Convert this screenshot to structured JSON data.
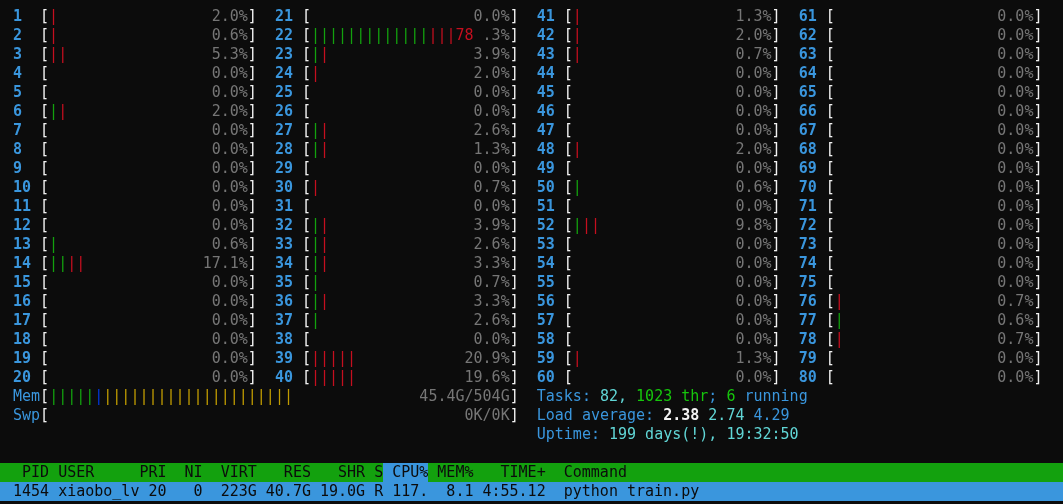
{
  "cpu_meters": [
    {
      "label": "1",
      "open": "[",
      "segments": [
        {
          "text": "|",
          "kind": "kernel"
        }
      ],
      "reading": "2.0%",
      "close": "]"
    },
    {
      "label": "2",
      "open": "[",
      "segments": [
        {
          "text": "|",
          "kind": "kernel"
        }
      ],
      "reading": "0.6%",
      "close": "]"
    },
    {
      "label": "3",
      "open": "[",
      "segments": [
        {
          "text": "||",
          "kind": "kernel"
        }
      ],
      "reading": "5.3%",
      "close": "]"
    },
    {
      "label": "4",
      "open": "[",
      "reading": "0.0%",
      "close": "]"
    },
    {
      "label": "5",
      "open": "[",
      "reading": "0.0%",
      "close": "]"
    },
    {
      "label": "6",
      "open": "[",
      "segments": [
        {
          "text": "|",
          "kind": "normal"
        },
        {
          "text": "|",
          "kind": "kernel"
        }
      ],
      "reading": "2.0%",
      "close": "]"
    },
    {
      "label": "7",
      "open": "[",
      "reading": "0.0%",
      "close": "]"
    },
    {
      "label": "8",
      "open": "[",
      "reading": "0.0%",
      "close": "]"
    },
    {
      "label": "9",
      "open": "[",
      "reading": "0.0%",
      "close": "]"
    },
    {
      "label": "10",
      "open": "[",
      "reading": "0.0%",
      "close": "]"
    },
    {
      "label": "11",
      "open": "[",
      "reading": "0.0%",
      "close": "]"
    },
    {
      "label": "12",
      "open": "[",
      "reading": "0.0%",
      "close": "]"
    },
    {
      "label": "13",
      "open": "[",
      "segments": [
        {
          "text": "|",
          "kind": "normal"
        }
      ],
      "reading": "0.6%",
      "close": "]"
    },
    {
      "label": "14",
      "open": "[",
      "segments": [
        {
          "text": "||",
          "kind": "normal"
        },
        {
          "text": "||",
          "kind": "kernel"
        }
      ],
      "reading": "17.1%",
      "close": "]"
    },
    {
      "label": "15",
      "open": "[",
      "reading": "0.0%",
      "close": "]"
    },
    {
      "label": "16",
      "open": "[",
      "reading": "0.0%",
      "close": "]"
    },
    {
      "label": "17",
      "open": "[",
      "reading": "0.0%",
      "close": "]"
    },
    {
      "label": "18",
      "open": "[",
      "reading": "0.0%",
      "close": "]"
    },
    {
      "label": "19",
      "open": "[",
      "reading": "0.0%",
      "close": "]"
    },
    {
      "label": "20",
      "open": "[",
      "reading": "0.0%",
      "close": "]"
    },
    {
      "label": "21",
      "open": "[",
      "reading": "0.0%",
      "close": "]"
    },
    {
      "label": "22",
      "open": "[",
      "segments": [
        {
          "text": "|||||||||||||",
          "kind": "normal"
        },
        {
          "text": "|||78",
          "kind": "kernel"
        }
      ],
      "reading": ".3%",
      "close": "]"
    },
    {
      "label": "23",
      "open": "[",
      "segments": [
        {
          "text": "|",
          "kind": "normal"
        },
        {
          "text": "|",
          "kind": "kernel"
        }
      ],
      "reading": "3.9%",
      "close": "]"
    },
    {
      "label": "24",
      "open": "[",
      "segments": [
        {
          "text": "|",
          "kind": "kernel"
        }
      ],
      "reading": "2.0%",
      "close": "]"
    },
    {
      "label": "25",
      "open": "[",
      "reading": "0.0%",
      "close": "]"
    },
    {
      "label": "26",
      "open": "[",
      "reading": "0.0%",
      "close": "]"
    },
    {
      "label": "27",
      "open": "[",
      "segments": [
        {
          "text": "|",
          "kind": "normal"
        },
        {
          "text": "|",
          "kind": "kernel"
        }
      ],
      "reading": "2.6%",
      "close": "]"
    },
    {
      "label": "28",
      "open": "[",
      "segments": [
        {
          "text": "|",
          "kind": "normal"
        },
        {
          "text": "|",
          "kind": "kernel"
        }
      ],
      "reading": "1.3%",
      "close": "]"
    },
    {
      "label": "29",
      "open": "[",
      "reading": "0.0%",
      "close": "]"
    },
    {
      "label": "30",
      "open": "[",
      "segments": [
        {
          "text": "|",
          "kind": "kernel"
        }
      ],
      "reading": "0.7%",
      "close": "]"
    },
    {
      "label": "31",
      "open": "[",
      "reading": "0.0%",
      "close": "]"
    },
    {
      "label": "32",
      "open": "[",
      "segments": [
        {
          "text": "|",
          "kind": "normal"
        },
        {
          "text": "|",
          "kind": "kernel"
        }
      ],
      "reading": "3.9%",
      "close": "]"
    },
    {
      "label": "33",
      "open": "[",
      "segments": [
        {
          "text": "|",
          "kind": "normal"
        },
        {
          "text": "|",
          "kind": "kernel"
        }
      ],
      "reading": "2.6%",
      "close": "]"
    },
    {
      "label": "34",
      "open": "[",
      "segments": [
        {
          "text": "|",
          "kind": "normal"
        },
        {
          "text": "|",
          "kind": "kernel"
        }
      ],
      "reading": "3.3%",
      "close": "]"
    },
    {
      "label": "35",
      "open": "[",
      "segments": [
        {
          "text": "|",
          "kind": "normal"
        }
      ],
      "reading": "0.7%",
      "close": "]"
    },
    {
      "label": "36",
      "open": "[",
      "segments": [
        {
          "text": "|",
          "kind": "normal"
        },
        {
          "text": "|",
          "kind": "kernel"
        }
      ],
      "reading": "3.3%",
      "close": "]"
    },
    {
      "label": "37",
      "open": "[",
      "segments": [
        {
          "text": "|",
          "kind": "normal"
        }
      ],
      "reading": "2.6%",
      "close": "]"
    },
    {
      "label": "38",
      "open": "[",
      "reading": "0.0%",
      "close": "]"
    },
    {
      "label": "39",
      "open": "[",
      "segments": [
        {
          "text": "|||||",
          "kind": "kernel"
        }
      ],
      "reading": "20.9%",
      "close": "]"
    },
    {
      "label": "40",
      "open": "[",
      "segments": [
        {
          "text": "|||||",
          "kind": "kernel"
        }
      ],
      "reading": "19.6%",
      "close": "]"
    },
    {
      "label": "41",
      "open": "[",
      "segments": [
        {
          "text": "|",
          "kind": "kernel"
        }
      ],
      "reading": "1.3%",
      "close": "]"
    },
    {
      "label": "42",
      "open": "[",
      "segments": [
        {
          "text": "|",
          "kind": "kernel"
        }
      ],
      "reading": "2.0%",
      "close": "]"
    },
    {
      "label": "43",
      "open": "[",
      "segments": [
        {
          "text": "|",
          "kind": "kernel"
        }
      ],
      "reading": "0.7%",
      "close": "]"
    },
    {
      "label": "44",
      "open": "[",
      "reading": "0.0%",
      "close": "]"
    },
    {
      "label": "45",
      "open": "[",
      "reading": "0.0%",
      "close": "]"
    },
    {
      "label": "46",
      "open": "[",
      "reading": "0.0%",
      "close": "]"
    },
    {
      "label": "47",
      "open": "[",
      "reading": "0.0%",
      "close": "]"
    },
    {
      "label": "48",
      "open": "[",
      "segments": [
        {
          "text": "|",
          "kind": "kernel"
        }
      ],
      "reading": "2.0%",
      "close": "]"
    },
    {
      "label": "49",
      "open": "[",
      "reading": "0.0%",
      "close": "]"
    },
    {
      "label": "50",
      "open": "[",
      "segments": [
        {
          "text": "|",
          "kind": "normal"
        }
      ],
      "reading": "0.6%",
      "close": "]"
    },
    {
      "label": "51",
      "open": "[",
      "reading": "0.0%",
      "close": "]"
    },
    {
      "label": "52",
      "open": "[",
      "segments": [
        {
          "text": "|",
          "kind": "normal"
        },
        {
          "text": "||",
          "kind": "kernel"
        }
      ],
      "reading": "9.8%",
      "close": "]"
    },
    {
      "label": "53",
      "open": "[",
      "reading": "0.0%",
      "close": "]"
    },
    {
      "label": "54",
      "open": "[",
      "reading": "0.0%",
      "close": "]"
    },
    {
      "label": "55",
      "open": "[",
      "reading": "0.0%",
      "close": "]"
    },
    {
      "label": "56",
      "open": "[",
      "reading": "0.0%",
      "close": "]"
    },
    {
      "label": "57",
      "open": "[",
      "reading": "0.0%",
      "close": "]"
    },
    {
      "label": "58",
      "open": "[",
      "reading": "0.0%",
      "close": "]"
    },
    {
      "label": "59",
      "open": "[",
      "segments": [
        {
          "text": "|",
          "kind": "kernel"
        }
      ],
      "reading": "1.3%",
      "close": "]"
    },
    {
      "label": "60",
      "open": "[",
      "reading": "0.0%",
      "close": "]"
    },
    {
      "label": "61",
      "open": "[",
      "reading": "0.0%",
      "close": "]"
    },
    {
      "label": "62",
      "open": "[",
      "reading": "0.0%",
      "close": "]"
    },
    {
      "label": "63",
      "open": "[",
      "reading": "0.0%",
      "close": "]"
    },
    {
      "label": "64",
      "open": "[",
      "reading": "0.0%",
      "close": "]"
    },
    {
      "label": "65",
      "open": "[",
      "reading": "0.0%",
      "close": "]"
    },
    {
      "label": "66",
      "open": "[",
      "reading": "0.0%",
      "close": "]"
    },
    {
      "label": "67",
      "open": "[",
      "reading": "0.0%",
      "close": "]"
    },
    {
      "label": "68",
      "open": "[",
      "reading": "0.0%",
      "close": "]"
    },
    {
      "label": "69",
      "open": "[",
      "reading": "0.0%",
      "close": "]"
    },
    {
      "label": "70",
      "open": "[",
      "reading": "0.0%",
      "close": "]"
    },
    {
      "label": "71",
      "open": "[",
      "reading": "0.0%",
      "close": "]"
    },
    {
      "label": "72",
      "open": "[",
      "reading": "0.0%",
      "close": "]"
    },
    {
      "label": "73",
      "open": "[",
      "reading": "0.0%",
      "close": "]"
    },
    {
      "label": "74",
      "open": "[",
      "reading": "0.0%",
      "close": "]"
    },
    {
      "label": "75",
      "open": "[",
      "reading": "0.0%",
      "close": "]"
    },
    {
      "label": "76",
      "open": "[",
      "segments": [
        {
          "text": "|",
          "kind": "kernel"
        }
      ],
      "reading": "0.7%",
      "close": "]"
    },
    {
      "label": "77",
      "open": "[",
      "segments": [
        {
          "text": "|",
          "kind": "normal"
        }
      ],
      "reading": "0.6%",
      "close": "]"
    },
    {
      "label": "78",
      "open": "[",
      "segments": [
        {
          "text": "|",
          "kind": "kernel"
        }
      ],
      "reading": "0.7%",
      "close": "]"
    },
    {
      "label": "79",
      "open": "[",
      "reading": "0.0%",
      "close": "]"
    },
    {
      "label": "80",
      "open": "[",
      "reading": "0.0%",
      "close": "]"
    }
  ],
  "memory_meters": [
    {
      "label": "Mem",
      "open": "[",
      "segments": [
        {
          "text": "|||||",
          "kind": "normal"
        },
        {
          "text": "|",
          "kind": "buffers"
        },
        {
          "text": "|||||||||||||||||||||",
          "kind": "cache"
        }
      ],
      "reading": "45.4G/504G",
      "close": "]"
    },
    {
      "label": "Swp",
      "open": "[",
      "reading": "0K/0K",
      "close": "]"
    }
  ],
  "summary_lines": [
    {
      "segments": [
        {
          "text": "Tasks: ",
          "kind": "label"
        },
        {
          "text": "82, ",
          "kind": "value"
        },
        {
          "text": "1023 thr",
          "kind": "highlight"
        },
        {
          "text": "; ",
          "kind": "label"
        },
        {
          "text": "6",
          "kind": "highlight"
        },
        {
          "text": " running",
          "kind": "label"
        }
      ]
    },
    {
      "segments": [
        {
          "text": "Load average: ",
          "kind": "label"
        },
        {
          "text": "2.38 ",
          "kind": "bright"
        },
        {
          "text": "2.74 ",
          "kind": "value"
        },
        {
          "text": "4.29",
          "kind": "label"
        }
      ]
    },
    {
      "segments": [
        {
          "text": "Uptime: ",
          "kind": "label"
        },
        {
          "text": "199 days(!), 19:32:50",
          "kind": "value"
        }
      ]
    }
  ],
  "process_table": {
    "columns": [
      {
        "label": "PID",
        "sorted": false
      },
      {
        "label": "USER",
        "sorted": false
      },
      {
        "label": "PRI",
        "sorted": false
      },
      {
        "label": "NI",
        "sorted": false
      },
      {
        "label": "VIRT",
        "sorted": false
      },
      {
        "label": "RES",
        "sorted": false
      },
      {
        "label": "SHR",
        "sorted": false
      },
      {
        "label": "S",
        "sorted": false
      },
      {
        "label": "CPU%",
        "sorted": true
      },
      {
        "label": "MEM%",
        "sorted": false
      },
      {
        "label": "TIME+",
        "sorted": false
      },
      {
        "label": "Command",
        "sorted": false
      }
    ],
    "rows": [
      {
        "selected": true,
        "cells": [
          "1454",
          "xiaobo_lv",
          "20",
          "0",
          "223G",
          "40.7G",
          "19.0G",
          "R",
          "117.",
          "8.1",
          "4:55.12",
          "python train.py"
        ]
      }
    ]
  }
}
